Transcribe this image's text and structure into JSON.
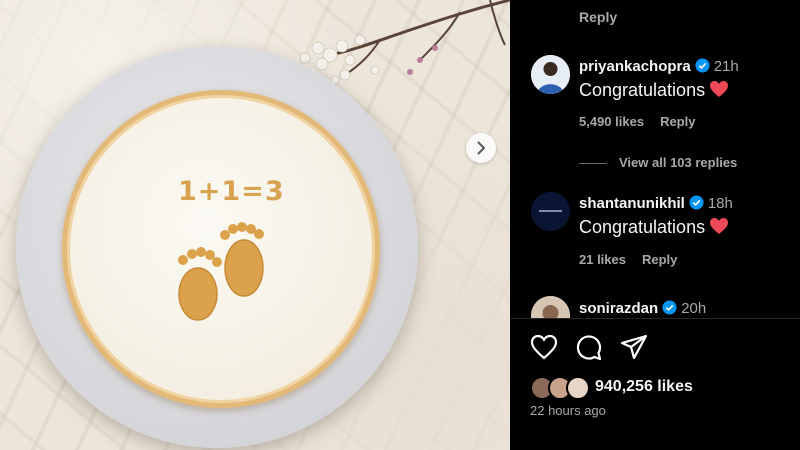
{
  "post_image": {
    "cake_text": "1+1=3"
  },
  "comments": {
    "top_reply_label": "Reply",
    "items": [
      {
        "username": "priyankachopra",
        "verified": true,
        "time": "21h",
        "text": "Congratulations",
        "likes": "5,490 likes",
        "reply_label": "Reply",
        "view_replies": "View all 103 replies"
      },
      {
        "username": "shantanunikhil",
        "verified": true,
        "time": "18h",
        "text": "Congratulations",
        "likes": "21 likes",
        "reply_label": "Reply"
      },
      {
        "username": "sonirazdan",
        "verified": true,
        "time": "20h"
      }
    ]
  },
  "actions": {
    "icons": [
      "heart-icon",
      "comment-icon",
      "share-icon"
    ]
  },
  "post_stats": {
    "likes": "940,256 likes",
    "posted": "22 hours ago"
  },
  "colors": {
    "background": "#000000",
    "verified_blue": "#0095f6",
    "heart_red": "#ed4956",
    "muted_text": "#a8a8a8",
    "cake_gold": "#d8a24e"
  }
}
